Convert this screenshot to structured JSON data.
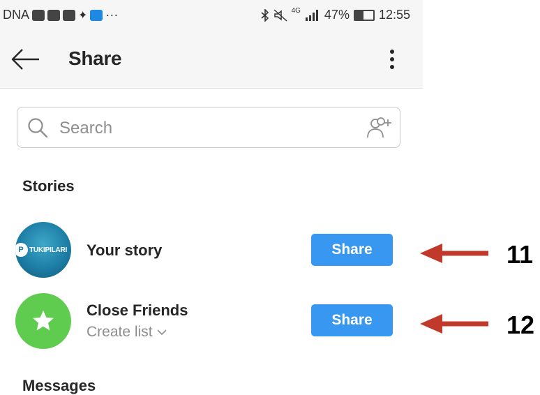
{
  "status_bar": {
    "left_text": "DNA",
    "more": "···",
    "signal_label": "4G",
    "battery": "47%",
    "time": "12:55",
    "battery_level": 0.47
  },
  "appbar": {
    "title": "Share"
  },
  "search": {
    "placeholder": "Search"
  },
  "sections": {
    "stories": "Stories",
    "messages": "Messages"
  },
  "rows": [
    {
      "title": "Your story",
      "avatar_brand": "TUKIPILARI",
      "avatar_mark": "P",
      "button": "Share"
    },
    {
      "title": "Close Friends",
      "subtitle": "Create list",
      "button": "Share"
    }
  ],
  "annotations": [
    {
      "number": "11"
    },
    {
      "number": "12"
    }
  ],
  "colors": {
    "accent": "#3897f0",
    "close_friends": "#5fcb4f",
    "arrow": "#c0392b"
  }
}
